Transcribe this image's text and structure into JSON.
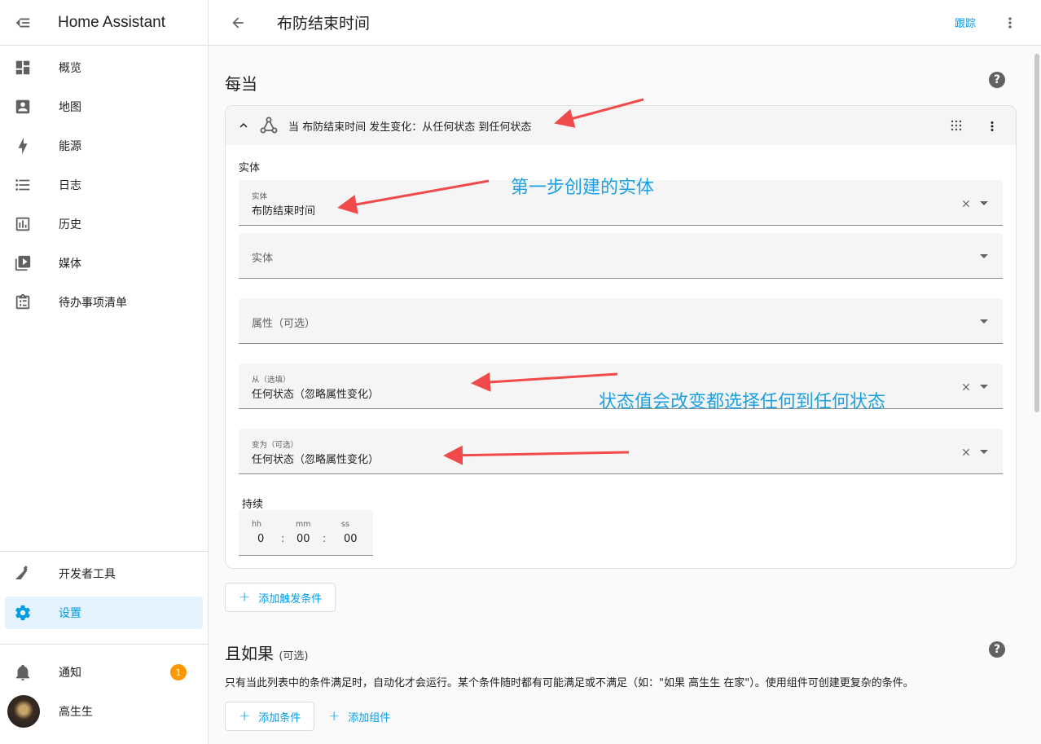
{
  "app": {
    "title": "Home Assistant"
  },
  "sidebar": {
    "items": [
      {
        "label": "概览",
        "icon": "dashboard-icon"
      },
      {
        "label": "地图",
        "icon": "account-box-icon"
      },
      {
        "label": "能源",
        "icon": "lightning-icon"
      },
      {
        "label": "日志",
        "icon": "list-icon"
      },
      {
        "label": "历史",
        "icon": "chart-box-icon"
      },
      {
        "label": "媒体",
        "icon": "play-box-icon"
      },
      {
        "label": "待办事项清单",
        "icon": "clipboard-list-icon"
      }
    ],
    "developer_tools": "开发者工具",
    "settings": "设置",
    "notifications": "通知",
    "notification_count": "1",
    "user": "高生生"
  },
  "header": {
    "title": "布防结束时间",
    "trace_label": "跟踪"
  },
  "triggers": {
    "title": "每当",
    "summary": "当 布防结束时间 发生变化：从任何状态 到任何状态",
    "entity_section_label": "实体",
    "fields": {
      "entity": {
        "label": "实体",
        "value": "布防结束时间"
      },
      "entity_empty": {
        "placeholder": "实体"
      },
      "attribute": {
        "placeholder": "属性（可选）"
      },
      "from": {
        "label": "从（选填）",
        "value": "任何状态（忽略属性变化）"
      },
      "to": {
        "label": "变为（可选）",
        "value": "任何状态（忽略属性变化）"
      }
    },
    "duration": {
      "label": "持续",
      "hh_label": "hh",
      "hh": "0",
      "mm_label": "mm",
      "mm": "00",
      "ss_label": "ss",
      "ss": "00"
    },
    "add_trigger_label": "添加触发条件"
  },
  "conditions": {
    "title": "且如果",
    "title_suffix": "(可选)",
    "description": "只有当此列表中的条件满足时，自动化才会运行。某个条件随时都有可能满足或不满足（如：\"如果 高生生 在家\"）。使用组件可创建更复杂的条件。",
    "add_condition_label": "添加条件",
    "add_building_block_label": "添加组件"
  },
  "annotations": {
    "entity_note": "第一步创建的实体",
    "state_note": "状态值会改变都选择任何到任何状态"
  },
  "colors": {
    "accent": "#039be5",
    "annotation_arrow": "#f04a4a",
    "annotation_text": "#1ba1e2",
    "badge": "#ff9800"
  }
}
